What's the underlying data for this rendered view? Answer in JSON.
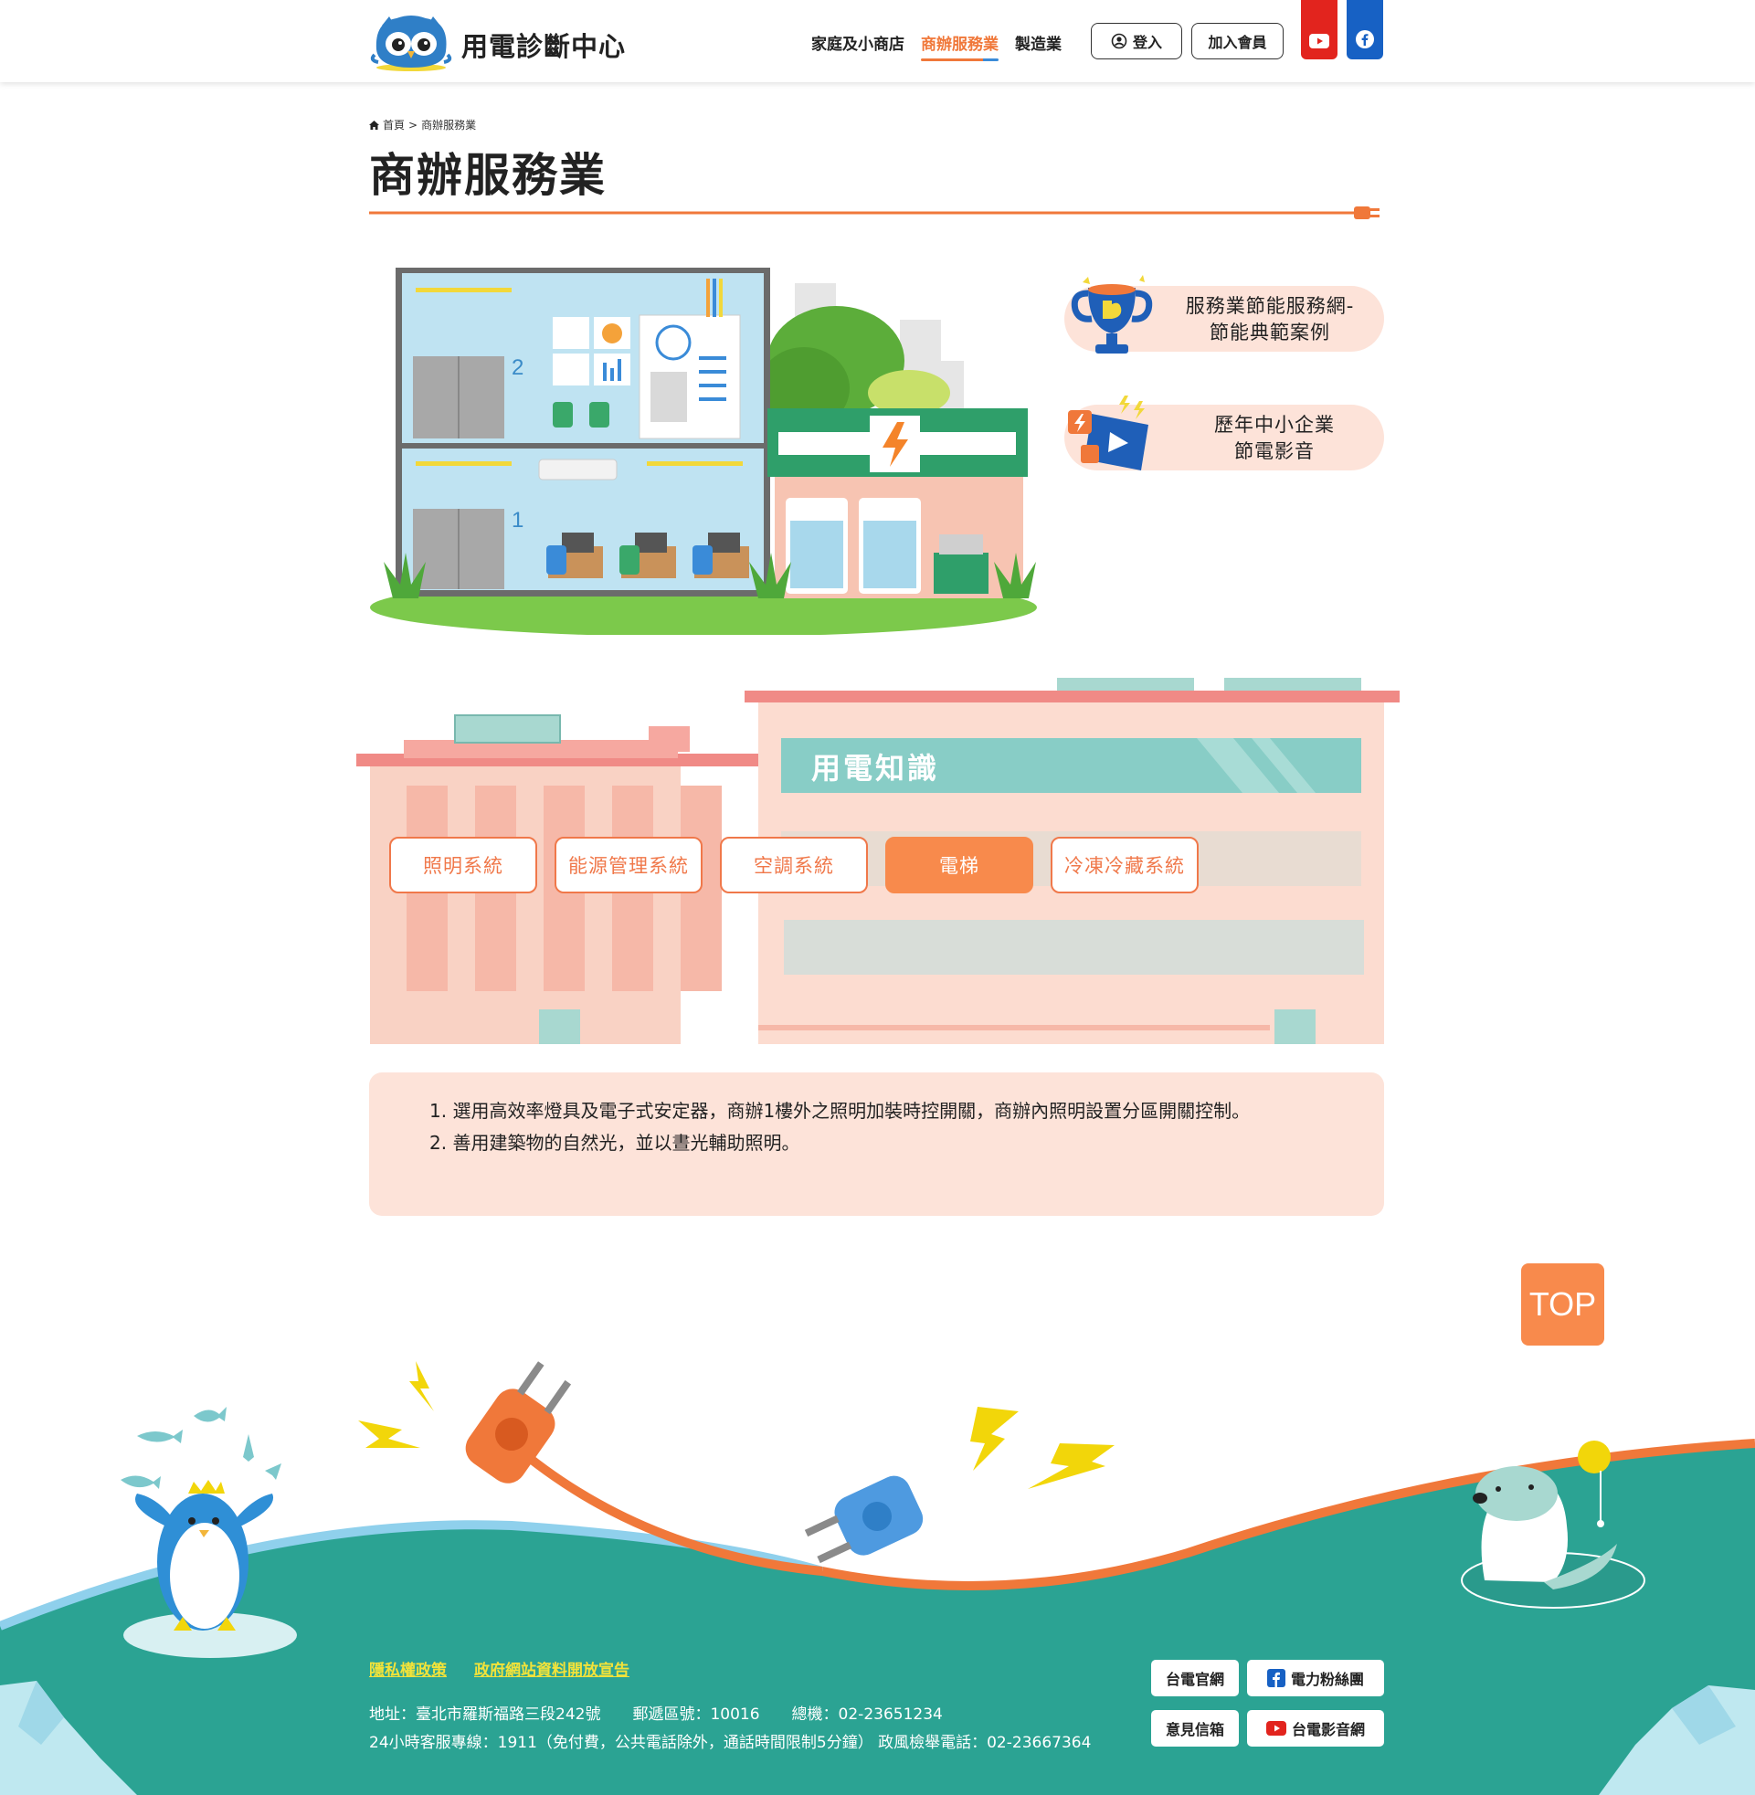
{
  "header": {
    "site_title": "用電診斷中心",
    "nav": [
      "家庭及小商店",
      "商辦服務業",
      "製造業"
    ],
    "nav_active_index": 1,
    "login_label": "登入",
    "join_label": "加入會員",
    "social": [
      "youtube-icon",
      "facebook-icon"
    ],
    "colors": {
      "youtube": "#e2241e",
      "facebook": "#1761c4",
      "accent": "#f0783a"
    }
  },
  "breadcrumb": {
    "home": "首頁",
    "separator": ">",
    "current": "商辦服務業"
  },
  "page_title": "商辦服務業",
  "links": [
    {
      "line1": "服務業節能服務網-",
      "line2": "節能典範案例"
    },
    {
      "line1": "歷年中小企業",
      "line2": "節電影音"
    }
  ],
  "knowledge": {
    "title": "用電知識",
    "tabs": [
      "照明系統",
      "能源管理系統",
      "空調系統",
      "電梯",
      "冷凍冷藏系統"
    ],
    "active_tab": 3,
    "content": [
      "1. 選用高效率燈具及電子式安定器，商辦1樓外之照明加裝時控開關，商辦內照明設置分區開關控制。",
      "2. 善用建築物的自然光，並以晝光輔助照明。"
    ]
  },
  "top_button": "TOP",
  "footer": {
    "links": [
      "隱私權政策",
      "政府網站資料開放宣告"
    ],
    "address": "地址：臺北市羅斯福路三段242號",
    "postal": "郵遞區號：10016",
    "phone": "總機：02-23651234",
    "hotline": "24小時客服專線：1911（免付費，公共電話除外，通話時間限制5分鐘） 政風檢舉電話：02-23667364",
    "buttons": [
      "台電官網",
      "電力粉絲團",
      "意見信箱",
      "台電影音網"
    ]
  }
}
